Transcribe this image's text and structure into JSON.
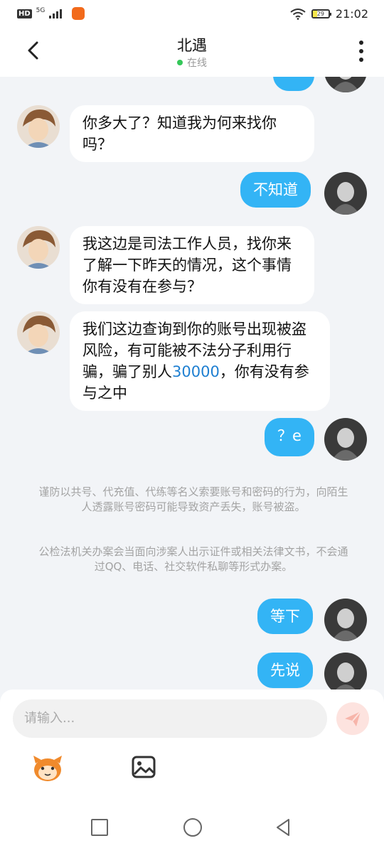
{
  "status_bar": {
    "hd": "HD",
    "network": "5G",
    "battery": "29",
    "time": "21:02"
  },
  "header": {
    "title": "北遇",
    "status": "在线"
  },
  "messages": {
    "m1": "你多大了？知道我为何来找你吗？",
    "m2": "不知道",
    "m3": "我这边是司法工作人员，找你来了解一下昨天的情况，这个事情你有没有在参与？",
    "m4_a": "我们这边查询到你的账号出现被盗风险，有可能被不法分子利用行骗，骗了别人",
    "m4_num": "30000",
    "m4_b": "，你有没有参与之中",
    "m5": "？e",
    "m6": "等下",
    "m7": "先说"
  },
  "notices": {
    "n1": "谨防以共号、代充值、代练等名义索要账号和密码的行为，向陌生人透露账号密码可能导致资产丢失，账号被盗。",
    "n2": "公检法机关办案会当面向涉案人出示证件或相关法律文书，不会通过QQ、电话、社交软件私聊等形式办案。"
  },
  "input": {
    "placeholder": "请输入..."
  },
  "colors": {
    "accent": "#33b4f5",
    "online": "#35c759",
    "send": "#fde3df",
    "number": "#1e7fd1"
  },
  "icons": [
    "back-icon",
    "more-icon",
    "send-icon",
    "emoji-icon",
    "image-icon",
    "nav-square-icon",
    "nav-circle-icon",
    "nav-back-icon"
  ]
}
